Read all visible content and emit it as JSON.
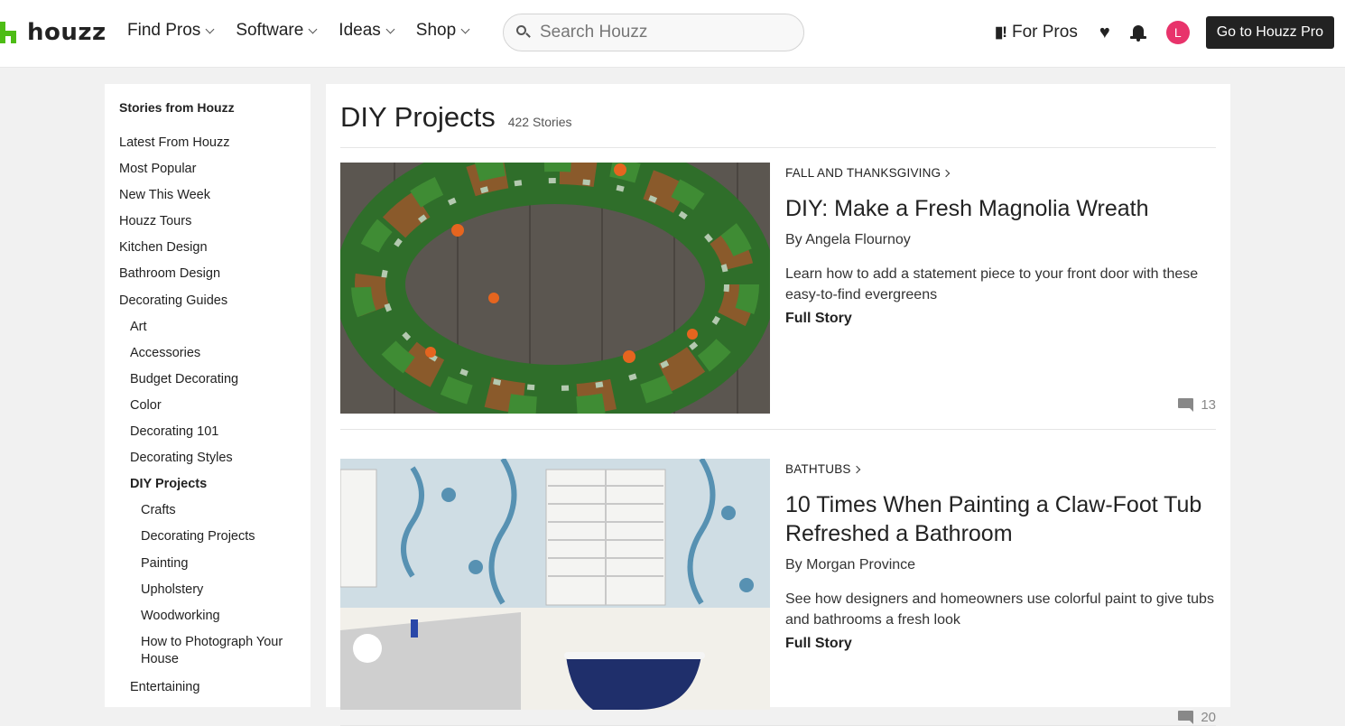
{
  "header": {
    "logo_text": "houzz",
    "nav": [
      {
        "label": "Find Pros"
      },
      {
        "label": "Software"
      },
      {
        "label": "Ideas"
      },
      {
        "label": "Shop"
      }
    ],
    "search_placeholder": "Search Houzz",
    "for_pros_label": "For Pros",
    "avatar_initial": "L",
    "pro_button_label": "Go to Houzz Pro"
  },
  "sidebar": {
    "heading": "Stories from Houzz",
    "links": [
      {
        "label": "Latest From Houzz",
        "level": 1
      },
      {
        "label": "Most Popular",
        "level": 1
      },
      {
        "label": "New This Week",
        "level": 1
      },
      {
        "label": "Houzz Tours",
        "level": 1
      },
      {
        "label": "Kitchen Design",
        "level": 1
      },
      {
        "label": "Bathroom Design",
        "level": 1
      },
      {
        "label": "Decorating Guides",
        "level": 1
      },
      {
        "label": "Art",
        "level": 2
      },
      {
        "label": "Accessories",
        "level": 2
      },
      {
        "label": "Budget Decorating",
        "level": 2
      },
      {
        "label": "Color",
        "level": 2
      },
      {
        "label": "Decorating 101",
        "level": 2
      },
      {
        "label": "Decorating Styles",
        "level": 2
      },
      {
        "label": "DIY Projects",
        "level": 2,
        "active": true
      },
      {
        "label": "Crafts",
        "level": 3
      },
      {
        "label": "Decorating Projects",
        "level": 3
      },
      {
        "label": "Painting",
        "level": 3
      },
      {
        "label": "Upholstery",
        "level": 3
      },
      {
        "label": "Woodworking",
        "level": 3
      },
      {
        "label": "How to Photograph Your House",
        "level": 3
      },
      {
        "label": "Entertaining",
        "level": 2
      }
    ]
  },
  "main": {
    "title": "DIY Projects",
    "story_count": "422 Stories",
    "stories": [
      {
        "category": "FALL AND THANKSGIVING",
        "title": "DIY: Make a Fresh Magnolia Wreath",
        "author": "By Angela Flournoy",
        "excerpt": "Learn how to add a statement piece to your front door with these easy-to-find evergreens",
        "cta": "Full Story",
        "comments": "13"
      },
      {
        "category": "BATHTUBS",
        "title": "10 Times When Painting a Claw-Foot Tub Refreshed a Bathroom",
        "author": "By Morgan Province",
        "excerpt": "See how designers and homeowners use colorful paint to give tubs and bathrooms a fresh look",
        "cta": "Full Story",
        "comments": "20"
      }
    ]
  },
  "colors": {
    "brand_green": "#4dbc15",
    "avatar_pink": "#e8336b",
    "pro_button": "#222222"
  }
}
